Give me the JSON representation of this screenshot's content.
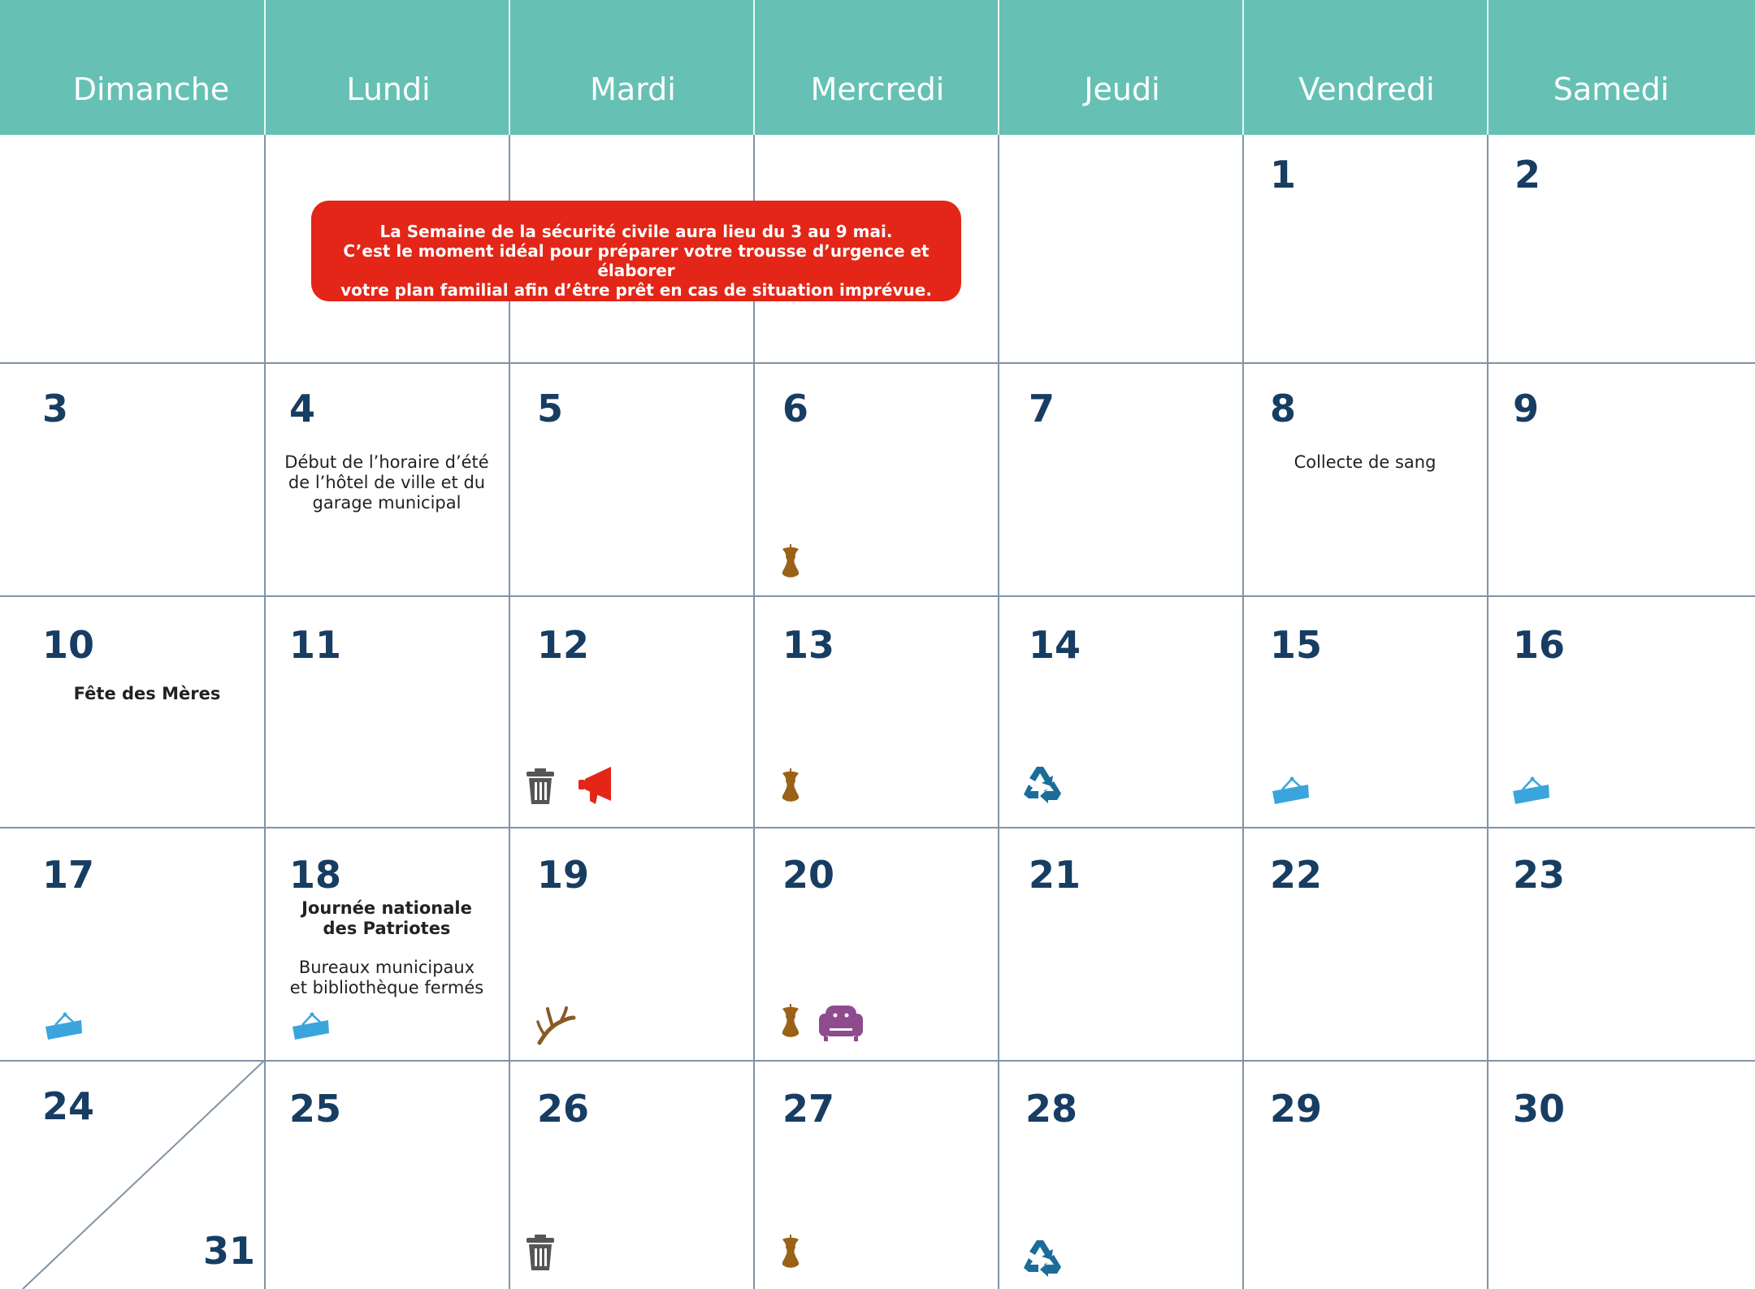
{
  "weekdays": [
    "Dimanche",
    "Lundi",
    "Mardi",
    "Mercredi",
    "Jeudi",
    "Vendredi",
    "Samedi"
  ],
  "banner": {
    "line1": "La Semaine de la sécurité civile aura lieu du 3 au 9 mai.",
    "line2": "C’est le moment idéal pour préparer votre trousse d’urgence et élaborer",
    "line3": "votre plan familial afin d’être prêt en cas de situation imprévue."
  },
  "days": {
    "d1": "1",
    "d2": "2",
    "d3": "3",
    "d4": "4",
    "d5": "5",
    "d6": "6",
    "d7": "7",
    "d8": "8",
    "d9": "9",
    "d10": "10",
    "d11": "11",
    "d12": "12",
    "d13": "13",
    "d14": "14",
    "d15": "15",
    "d16": "16",
    "d17": "17",
    "d18": "18",
    "d19": "19",
    "d20": "20",
    "d21": "21",
    "d22": "22",
    "d23": "23",
    "d24": "24",
    "d25": "25",
    "d26": "26",
    "d27": "27",
    "d28": "28",
    "d29": "29",
    "d30": "30",
    "d31": "31"
  },
  "events": {
    "horaire_l1": "Début de l’horaire d’été",
    "horaire_l2": "de l’hôtel de ville et du",
    "horaire_l3": "garage municipal",
    "collecte": "Collecte de sang",
    "fete_meres": "Fête des Mères",
    "patriotes_l1": "Journée nationale",
    "patriotes_l2": "des Patriotes",
    "bureaux_l1": "Bureaux municipaux",
    "bureaux_l2": "et bibliothèque fermés"
  },
  "icons": {
    "compost": "apple-core-icon",
    "trash": "trash-can-icon",
    "recycling": "recycling-icon",
    "sign": "hanging-sign-icon",
    "megaphone": "megaphone-icon",
    "branch": "branch-icon",
    "furniture": "armchair-icon"
  },
  "colors": {
    "header": "#66c1b4",
    "day_number": "#173d62",
    "banner": "#e32617",
    "compost": "#9a6218",
    "trash": "#555555",
    "recycling": "#1a6d9a",
    "sign": "#3aa5dd",
    "megaphone": "#e32617",
    "furniture": "#8e4b8e"
  }
}
